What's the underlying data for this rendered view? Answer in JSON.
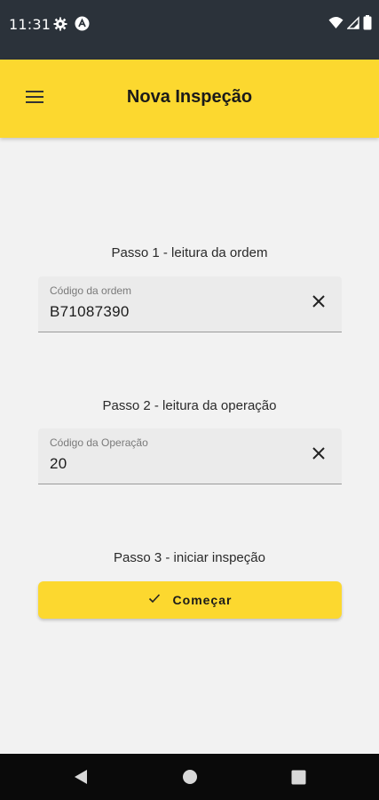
{
  "status_bar": {
    "time": "11:31",
    "left_icons": [
      "settings-icon",
      "a-circle-icon"
    ],
    "right_icons": [
      "wifi-icon",
      "signal-icon",
      "battery-icon"
    ]
  },
  "app_bar": {
    "title": "Nova Inspeção",
    "menu_icon": "hamburger-menu-icon",
    "background": "#fcd82f"
  },
  "steps": [
    {
      "label": "Passo 1 - leitura da ordem",
      "field_label": "Código da ordem",
      "field_value": "B71087390"
    },
    {
      "label": "Passo 2 - leitura da operação",
      "field_label": "Código da Operação",
      "field_value": "20"
    },
    {
      "label": "Passo 3 - iniciar inspeção"
    }
  ],
  "start_button": {
    "label": "Começar",
    "icon": "check-icon"
  },
  "nav_bar": {
    "buttons": [
      "back-icon",
      "home-icon",
      "recents-icon"
    ]
  }
}
